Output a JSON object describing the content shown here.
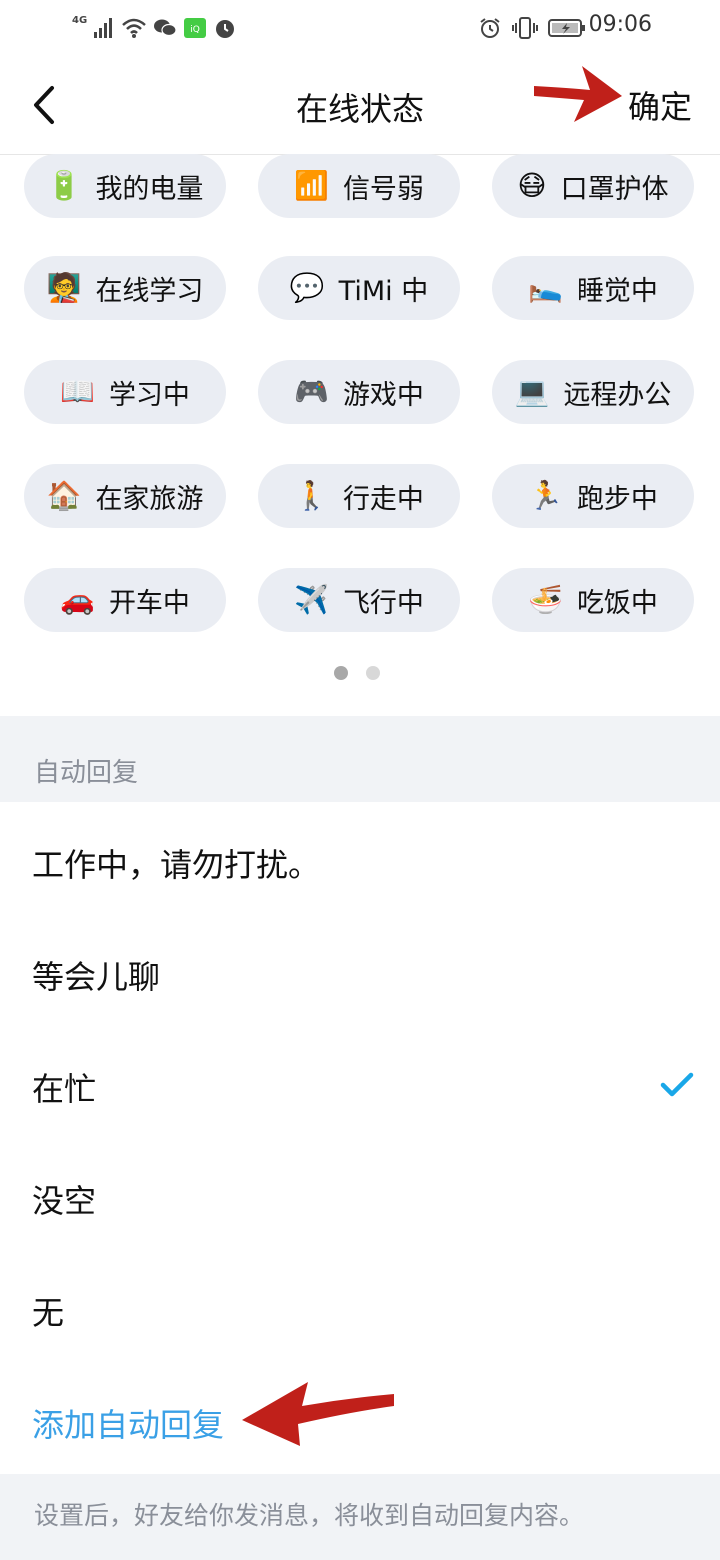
{
  "statusbar": {
    "network": "4G",
    "time": "09:06"
  },
  "nav": {
    "title": "在线状态",
    "confirm": "确定"
  },
  "statuses": [
    {
      "icon": "battery-icon",
      "emoji": "🔋",
      "label": "我的电量"
    },
    {
      "icon": "signal-icon",
      "emoji": "📶",
      "label": "信号弱"
    },
    {
      "icon": "mask-icon",
      "emoji": "😷",
      "label": "口罩护体"
    },
    {
      "icon": "study-board-icon",
      "emoji": "🧑‍🏫",
      "label": "在线学习"
    },
    {
      "icon": "timi-icon",
      "emoji": "💬",
      "label": "TiMi 中"
    },
    {
      "icon": "bed-icon",
      "emoji": "🛌",
      "label": "睡觉中"
    },
    {
      "icon": "book-icon",
      "emoji": "📖",
      "label": "学习中"
    },
    {
      "icon": "gamepad-icon",
      "emoji": "🎮",
      "label": "游戏中"
    },
    {
      "icon": "laptop-icon",
      "emoji": "💻",
      "label": "远程办公"
    },
    {
      "icon": "house-icon",
      "emoji": "🏠",
      "label": "在家旅游"
    },
    {
      "icon": "walking-icon",
      "emoji": "🚶",
      "label": "行走中"
    },
    {
      "icon": "running-icon",
      "emoji": "🏃",
      "label": "跑步中"
    },
    {
      "icon": "car-icon",
      "emoji": "🚗",
      "label": "开车中"
    },
    {
      "icon": "airplane-icon",
      "emoji": "✈️",
      "label": "飞行中"
    },
    {
      "icon": "noodle-bowl-icon",
      "emoji": "🍜",
      "label": "吃饭中"
    }
  ],
  "pagination": {
    "pages": 2,
    "current": 1
  },
  "auto_reply": {
    "header": "自动回复",
    "items": [
      {
        "label": "工作中，请勿打扰。",
        "selected": false
      },
      {
        "label": "等会儿聊",
        "selected": false
      },
      {
        "label": "在忙",
        "selected": true
      },
      {
        "label": "没空",
        "selected": false
      },
      {
        "label": "无",
        "selected": false
      }
    ],
    "add_label": "添加自动回复",
    "footer": "设置后，好友给你发消息，将收到自动回复内容。"
  },
  "colors": {
    "accent": "#3aa0e6",
    "check": "#19a7e8",
    "chip_bg": "#eaedf3",
    "section_bg": "#f1f3f6",
    "annotation_arrow": "#c0201a"
  }
}
